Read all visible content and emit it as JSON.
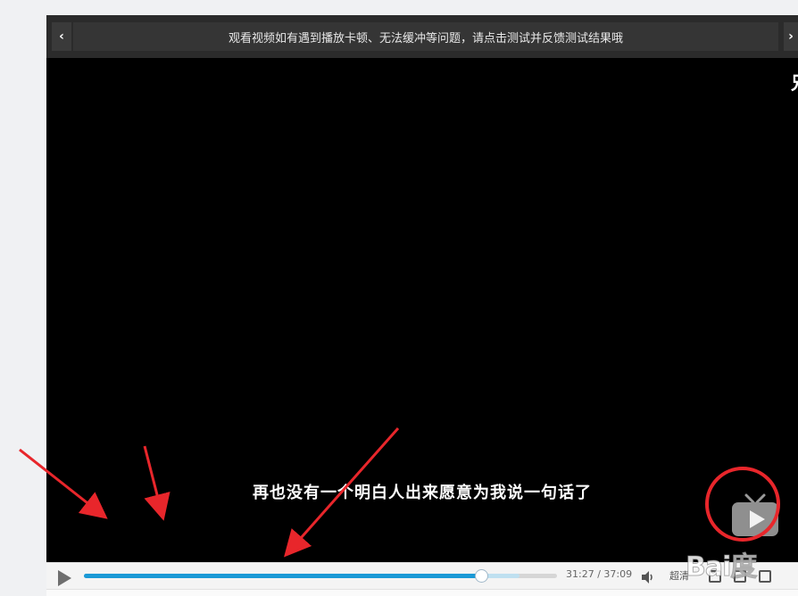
{
  "notice": {
    "prev_label": "‹",
    "next_label": "›",
    "text": "观看视频如有遇到播放卡顿、无法缓冲等问题，请点击测试并反馈测试结果哦"
  },
  "video": {
    "subtitle": "再也没有一个明白人出来愿意为我说一句话了",
    "edge_glyph": "兄"
  },
  "controls": {
    "progress_fraction": 0.84,
    "buffered_fraction": 0.92,
    "time_display": "31:27 / 37:09",
    "quality_label": "超清"
  },
  "colors": {
    "accent": "#1b9ad6",
    "annotation": "#e8262b"
  },
  "watermark": {
    "text": "Bai度"
  }
}
